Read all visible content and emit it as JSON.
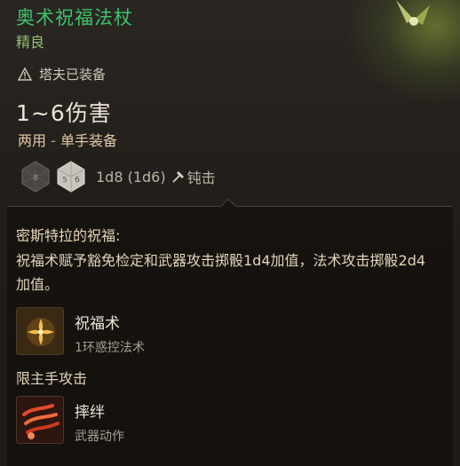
{
  "item": {
    "name": "奥术祝福法杖",
    "rarity": "精良",
    "equipped_by": "塔夫已装备",
    "damage": "1~6伤害",
    "handed_main": "两用",
    "handed_sep": " - ",
    "handed_sub": "单手装备",
    "dice_text": "1d8 (1d6)",
    "damage_type": "钝击"
  },
  "blessing": {
    "title": "密斯特拉的祝福:",
    "description": "祝福术赋予豁免检定和武器攻击掷骰1d4加值，法术攻击掷骰2d4加值。"
  },
  "abilities": [
    {
      "name": "祝福术",
      "sub": "1环惑控法术",
      "icon": "bless-icon"
    },
    {
      "name": "摔绊",
      "sub": "武器动作",
      "icon": "topple-icon"
    }
  ],
  "main_hand_label": "限主手攻击",
  "colors": {
    "item_name": "#3fc26a",
    "rarity": "#8fbf73",
    "background": "#221e1b"
  }
}
